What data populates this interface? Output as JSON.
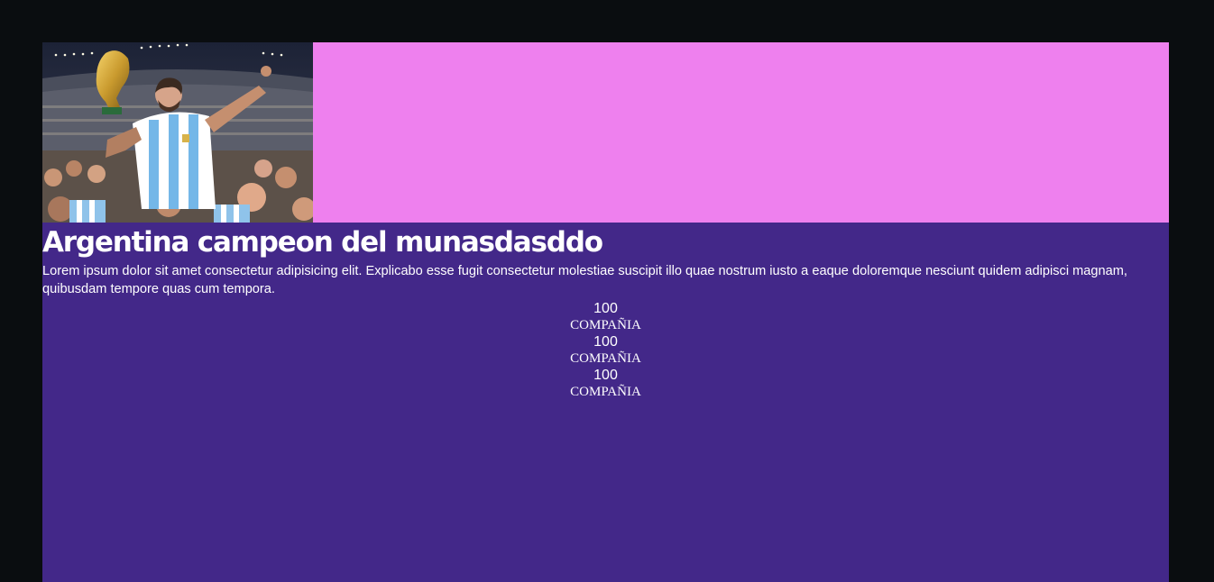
{
  "hero": {
    "accent_color": "#ee80ee",
    "photo_alt": "player-lifting-trophy"
  },
  "main": {
    "title": "Argentina campeon del munasdasddo",
    "description": "Lorem ipsum dolor sit amet consectetur adipisicing elit. Explicabo esse fugit consectetur molestiae suscipit illo quae nostrum iusto a eaque doloremque nesciunt quidem adipisci magnam, quibusdam tempore quas cum tempora.",
    "background_color": "#432889"
  },
  "stats": [
    {
      "number": "100",
      "label": "COMPAÑIA"
    },
    {
      "number": "100",
      "label": "COMPAÑIA"
    },
    {
      "number": "100",
      "label": "COMPAÑIA"
    }
  ]
}
